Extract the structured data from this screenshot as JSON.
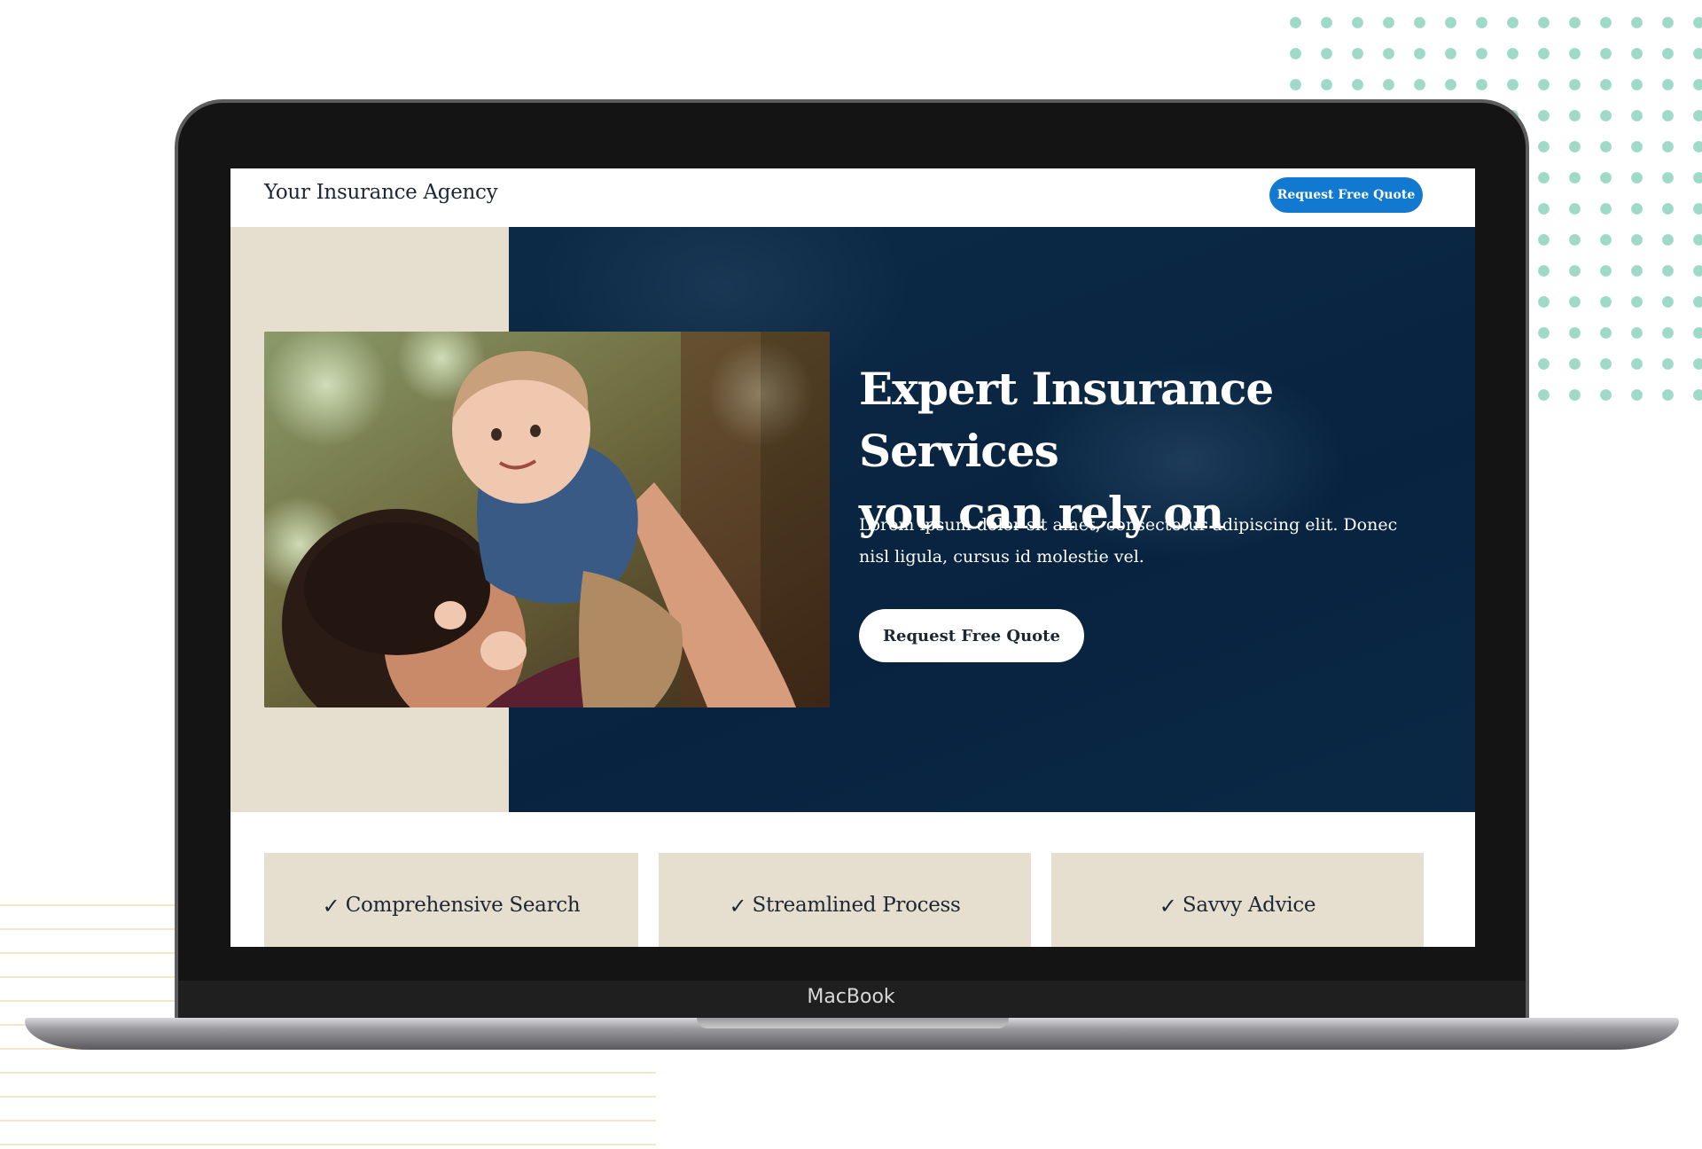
{
  "device": {
    "brand_label": "MacBook"
  },
  "nav": {
    "brand": "Your Insurance Agency",
    "cta_label": "Request Free Quote"
  },
  "hero": {
    "title_line1": "Expert Insurance Services",
    "title_line2": "you can rely on",
    "text": "Lorem ipsum dolor sit amet, consectetur adipiscing elit. Donec nisl ligula, cursus id molestie vel.",
    "cta_label": "Request Free Quote",
    "photo_icon": "family-photo"
  },
  "features": [
    {
      "icon": "check-icon",
      "check": "✓",
      "label": "Comprehensive Search"
    },
    {
      "icon": "check-icon",
      "check": "✓",
      "label": "Streamlined Process"
    },
    {
      "icon": "check-icon",
      "check": "✓",
      "label": "Savvy Advice"
    }
  ],
  "colors": {
    "primary_blue": "#1279d0",
    "navy": "#0a2845",
    "beige": "#e6dfcf",
    "dot_mint": "#9fd9c7",
    "line_cream": "#f2e7c9"
  }
}
